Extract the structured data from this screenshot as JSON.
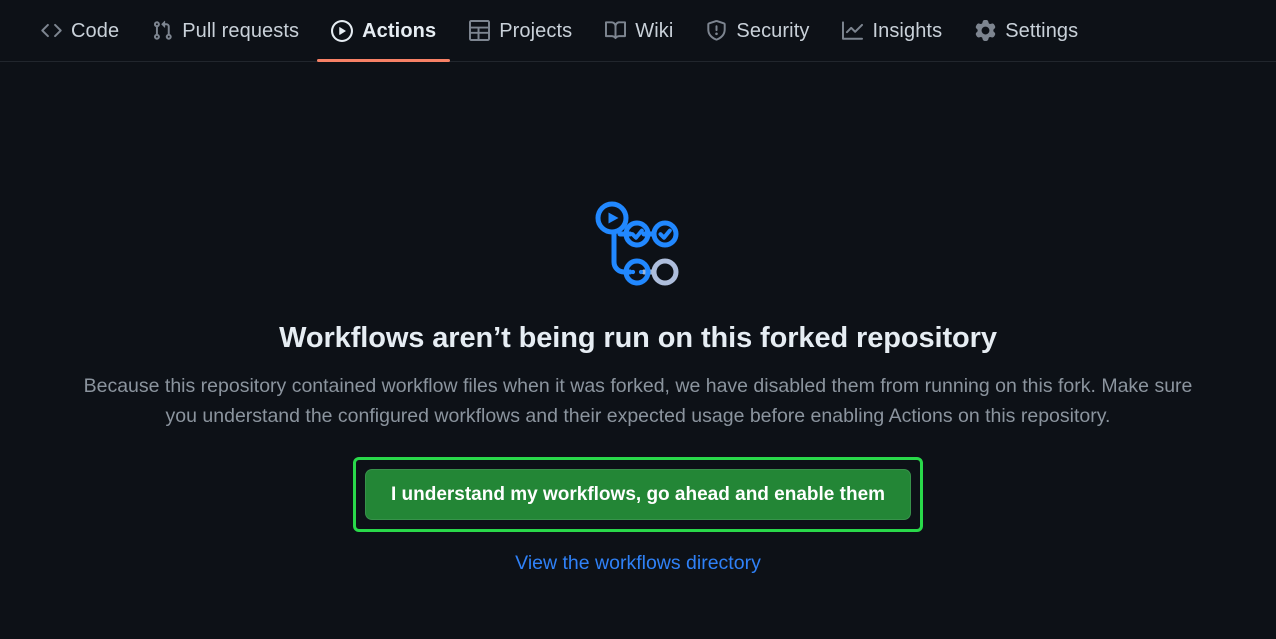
{
  "nav": {
    "items": [
      {
        "label": "Code",
        "icon": "code-icon",
        "active": false
      },
      {
        "label": "Pull requests",
        "icon": "git-pull-request-icon",
        "active": false
      },
      {
        "label": "Actions",
        "icon": "play-icon",
        "active": true
      },
      {
        "label": "Projects",
        "icon": "table-icon",
        "active": false
      },
      {
        "label": "Wiki",
        "icon": "book-icon",
        "active": false
      },
      {
        "label": "Security",
        "icon": "shield-icon",
        "active": false
      },
      {
        "label": "Insights",
        "icon": "graph-icon",
        "active": false
      },
      {
        "label": "Settings",
        "icon": "gear-icon",
        "active": false
      }
    ],
    "active_indicator_color": "#f78166"
  },
  "blankslate": {
    "illustration_icon": "workflow-graph-icon",
    "title": "Workflows aren’t being run on this forked repository",
    "description": "Because this repository contained workflow files when it was forked, we have disabled them from running on this fork. Make sure you understand the configured workflows and their expected usage before enabling Actions on this repository.",
    "enable_button_label": "I understand my workflows, go ahead and enable them",
    "view_link_label": "View the workflows directory"
  },
  "colors": {
    "page_background": "#0d1117",
    "button_green": "#238636",
    "highlight_ring_green": "#29d94a",
    "link_blue": "#2f81f7",
    "text_primary": "#e6edf3",
    "text_muted": "#8b949e"
  }
}
